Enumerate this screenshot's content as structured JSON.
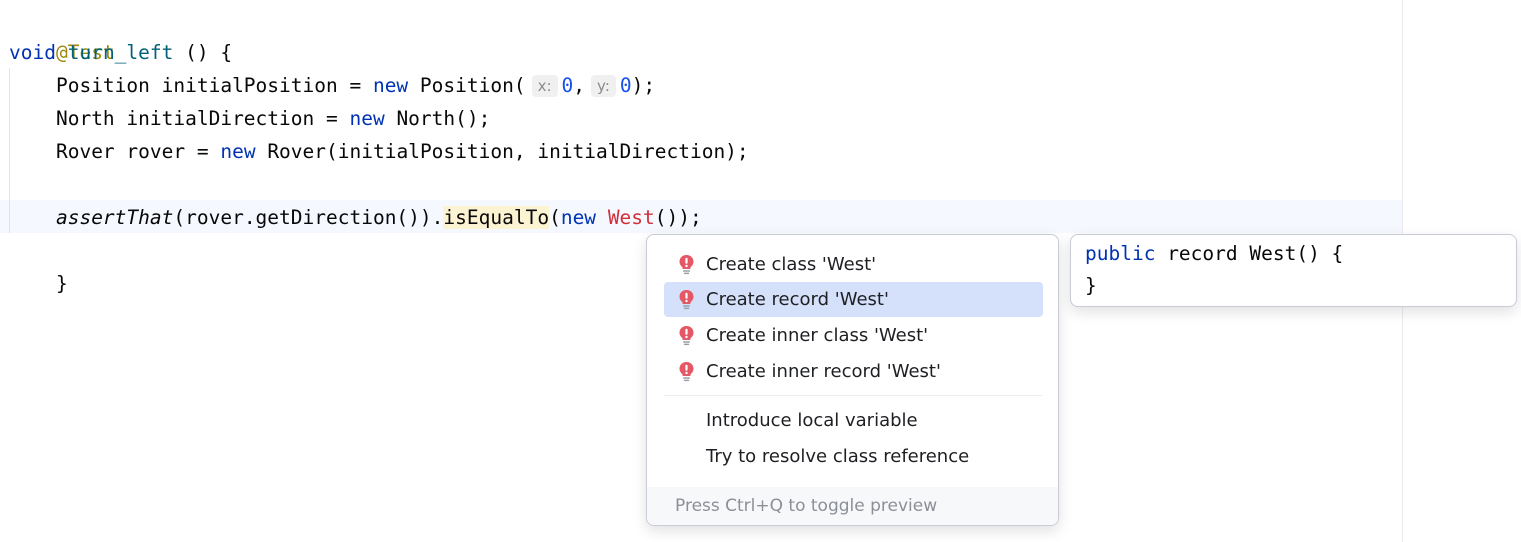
{
  "code": {
    "line1": {
      "annotation": "@Test"
    },
    "line2": {
      "kw_void": "void",
      "method": "turn_left",
      "rest": " () {"
    },
    "line3": {
      "type": "Position initialPosition = ",
      "kw_new": "new",
      "ctor": " Position(",
      "hint_x": "x:",
      "val_x": "0",
      "comma": ",",
      "hint_y": "y:",
      "val_y": "0",
      "end": ");"
    },
    "line4": {
      "type": "North initialDirection = ",
      "kw_new": "new",
      "ctor": " North();"
    },
    "line5": {
      "type": "Rover rover = ",
      "kw_new": "new",
      "ctor": " Rover(initialPosition, initialDirection);"
    },
    "line6": {
      "call": "assertThat",
      "args": "(rover.getDirection()).",
      "method_hl": "isEqualTo",
      "open": "(",
      "kw_new": "new",
      "space": " ",
      "error_class": "West",
      "end": "());"
    },
    "line7": {
      "brace": "}"
    }
  },
  "intention_menu": {
    "items": [
      {
        "label": "Create class 'West'",
        "icon": "error-bulb-icon"
      },
      {
        "label": "Create record 'West'",
        "icon": "error-bulb-icon",
        "selected": true
      },
      {
        "label": "Create inner class 'West'",
        "icon": "error-bulb-icon"
      },
      {
        "label": "Create inner record 'West'",
        "icon": "error-bulb-icon"
      },
      {
        "label": "Introduce local variable"
      },
      {
        "label": "Try to resolve class reference"
      }
    ],
    "footer": "Press Ctrl+Q to toggle preview"
  },
  "preview": {
    "kw_public": "public",
    "decl": " record West() {",
    "close": "}"
  },
  "colors": {
    "keyword": "#0033b3",
    "annotation": "#9e880d",
    "method_decl": "#00627a",
    "number": "#1750eb",
    "error": "#d12f3a",
    "selection": "#d5e1fb",
    "bulb_red": "#e55765"
  }
}
